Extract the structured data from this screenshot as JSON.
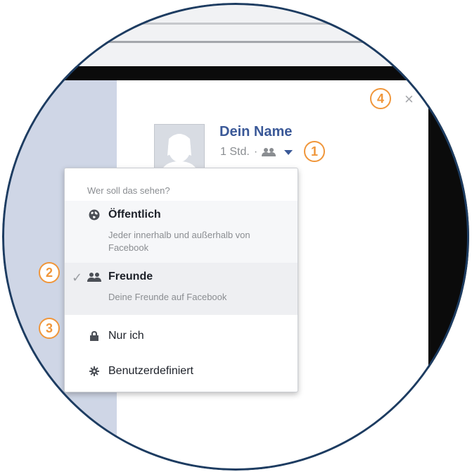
{
  "profile": {
    "name": "Dein Name",
    "time": "1 Std.",
    "separator": "·"
  },
  "close_icon": "×",
  "audience_menu": {
    "header": "Wer soll das sehen?",
    "items": [
      {
        "label": "Öffentlich",
        "description": "Jeder innerhalb und außerhalb von Facebook",
        "icon": "globe-icon",
        "selected": false
      },
      {
        "label": "Freunde",
        "description": "Deine Freunde auf Facebook",
        "icon": "friends-icon",
        "selected": true
      },
      {
        "label": "Nur ich",
        "description": "",
        "icon": "lock-icon",
        "selected": false
      },
      {
        "label": "Benutzerdefiniert",
        "description": "",
        "icon": "gear-icon",
        "selected": false
      }
    ],
    "checkmark": "✓"
  },
  "callouts": [
    "1",
    "2",
    "3",
    "4"
  ],
  "colors": {
    "accent": "#3b5998",
    "callout": "#f0963a",
    "ring": "#1d3c61",
    "selected_bg": "#eeeff2",
    "dark_bg": "#0b0b0b"
  }
}
